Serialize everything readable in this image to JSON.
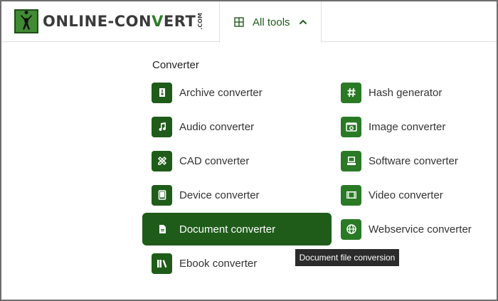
{
  "logo": {
    "part1": "ONLINE-CON",
    "part2": "V",
    "part3": "ERT",
    "com": ".COM"
  },
  "nav": {
    "all_tools_label": "All tools"
  },
  "section_title": "Converter",
  "left_items": [
    {
      "label": "Archive converter",
      "icon": "archive-icon"
    },
    {
      "label": "Audio converter",
      "icon": "music-note-icon"
    },
    {
      "label": "CAD converter",
      "icon": "cad-tools-icon"
    },
    {
      "label": "Device converter",
      "icon": "tablet-icon"
    },
    {
      "label": "Document converter",
      "icon": "document-icon",
      "active": true
    },
    {
      "label": "Ebook converter",
      "icon": "books-icon"
    }
  ],
  "right_items": [
    {
      "label": "Hash generator",
      "icon": "hash-icon"
    },
    {
      "label": "Image converter",
      "icon": "image-icon"
    },
    {
      "label": "Software converter",
      "icon": "monitor-icon"
    },
    {
      "label": "Video converter",
      "icon": "film-icon"
    },
    {
      "label": "Webservice converter",
      "icon": "globe-icon"
    }
  ],
  "tooltip": "Document file conversion",
  "colors": {
    "brand_green": "#1f5c1a",
    "accent_green": "#2a7a25",
    "tooltip_bg": "#2b2b2b"
  }
}
